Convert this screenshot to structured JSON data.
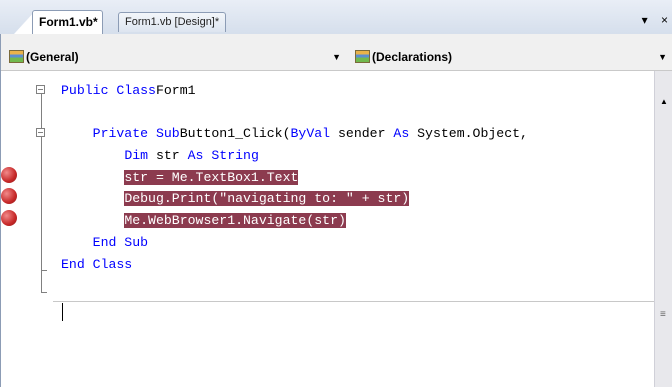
{
  "tabs": [
    {
      "label": "Form1.vb*",
      "active": true
    },
    {
      "label": "Form1.vb [Design]*",
      "active": false
    }
  ],
  "tabstrip_controls": {
    "dropdown_icon": "▾",
    "close_icon": "×"
  },
  "navbar": {
    "class_combo": {
      "value": "(General)",
      "icon": "class-icon"
    },
    "member_combo": {
      "value": "(Declarations)",
      "icon": "member-icon"
    }
  },
  "code_lines": [
    {
      "indent": "",
      "tokens": [
        [
          "kw",
          "Public Class"
        ],
        [
          "",
          "Form1"
        ]
      ],
      "breakpoint": false,
      "highlight": false
    },
    {
      "indent": "",
      "tokens": [],
      "breakpoint": false,
      "highlight": false
    },
    {
      "indent": "    ",
      "tokens": [
        [
          "kw",
          "Private Sub"
        ],
        [
          "",
          "Button1_Click("
        ],
        [
          "kw",
          "ByVal"
        ],
        [
          "",
          " sender "
        ],
        [
          "kw",
          "As"
        ],
        [
          "",
          " System.Object,"
        ]
      ],
      "breakpoint": false,
      "highlight": false
    },
    {
      "indent": "        ",
      "tokens": [
        [
          "kw",
          "Dim"
        ],
        [
          "",
          " str "
        ],
        [
          "kw",
          "As"
        ],
        [
          "kw",
          " String"
        ]
      ],
      "breakpoint": false,
      "highlight": false
    },
    {
      "indent": "        ",
      "tokens": [
        [
          "",
          "str = Me.TextBox1.Text"
        ]
      ],
      "breakpoint": true,
      "highlight": true
    },
    {
      "indent": "        ",
      "tokens": [
        [
          "",
          "Debug.Print(\"navigating to: \" + str)"
        ]
      ],
      "breakpoint": true,
      "highlight": true
    },
    {
      "indent": "        ",
      "tokens": [
        [
          "",
          "Me.WebBrowser1.Navigate(str)"
        ]
      ],
      "breakpoint": true,
      "highlight": true
    },
    {
      "indent": "    ",
      "tokens": [
        [
          "kw",
          "End Sub"
        ]
      ],
      "breakpoint": false,
      "highlight": false
    },
    {
      "indent": "",
      "tokens": [
        [
          "kw",
          "End Class"
        ]
      ],
      "breakpoint": false,
      "highlight": false
    }
  ],
  "colors": {
    "keyword": "#0000ff",
    "breakpoint_highlight": "#8c3b4f"
  }
}
